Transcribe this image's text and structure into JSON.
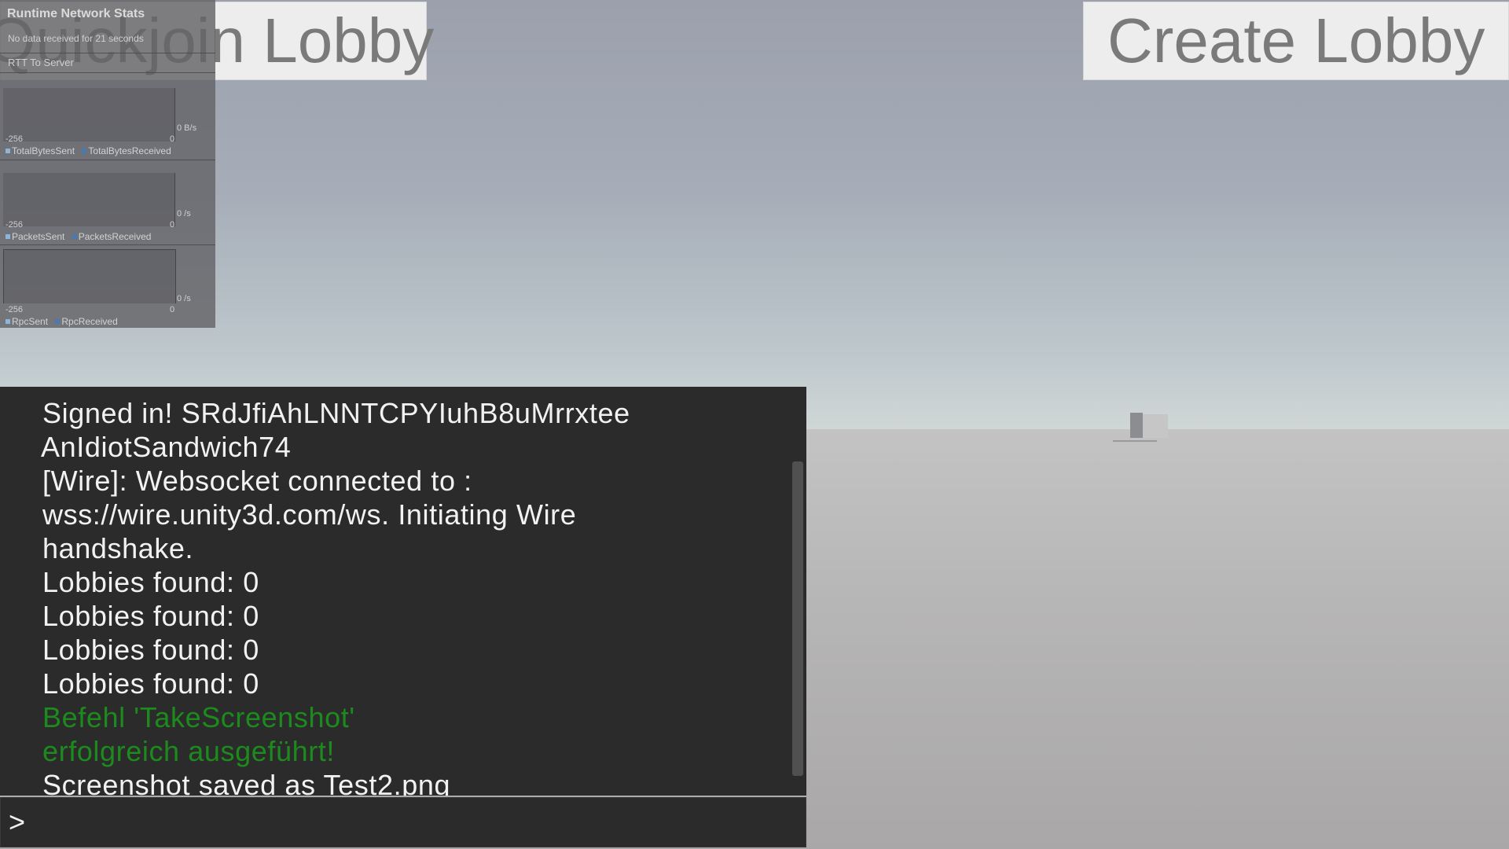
{
  "buttons": {
    "quickjoin_label": "Quickjoin Lobby",
    "create_label": "Create Lobby"
  },
  "netstats": {
    "title": "Runtime Network Stats",
    "no_data_text": "No data received for 21 seconds",
    "rtt_label": "RTT To Server",
    "graphs": [
      {
        "right_label": "0 B/s",
        "min_label": "-256",
        "zero_label": "0",
        "legend": [
          "TotalBytesSent",
          "TotalBytesReceived"
        ]
      },
      {
        "right_label": "0 /s",
        "min_label": "-256",
        "zero_label": "0",
        "legend": [
          "PacketsSent",
          "PacketsReceived"
        ]
      },
      {
        "right_label": "0 /s",
        "min_label": "-256",
        "zero_label": "0",
        "legend": [
          "RpcSent",
          "RpcReceived"
        ]
      }
    ],
    "colors": {
      "sent": "#8fb4d9",
      "received": "#4a78b0"
    }
  },
  "console": {
    "lines": [
      {
        "text": "Signed in! SRdJfiAhLNNTCPYIuhB8uMrrxtee",
        "color": "default"
      },
      {
        "text": "AnIdiotSandwich74",
        "color": "default"
      },
      {
        "text": "[Wire]: Websocket connected to :",
        "color": "default"
      },
      {
        "text": "wss://wire.unity3d.com/ws. Initiating Wire",
        "color": "default"
      },
      {
        "text": "handshake.",
        "color": "default"
      },
      {
        "text": "Lobbies found: 0",
        "color": "default"
      },
      {
        "text": "Lobbies found: 0",
        "color": "default"
      },
      {
        "text": "Lobbies found: 0",
        "color": "default"
      },
      {
        "text": "Lobbies found: 0",
        "color": "default"
      },
      {
        "text": "Befehl 'TakeScreenshot'",
        "color": "green"
      },
      {
        "text": "erfolgreich ausgeführt!",
        "color": "green"
      },
      {
        "text": "Screenshot saved as Test2.png",
        "color": "default"
      }
    ],
    "input_prompt": ">",
    "colors": {
      "default_text": "#f2f2f2",
      "success_text": "#1d8a1d",
      "background": "#2b2b2b"
    }
  }
}
